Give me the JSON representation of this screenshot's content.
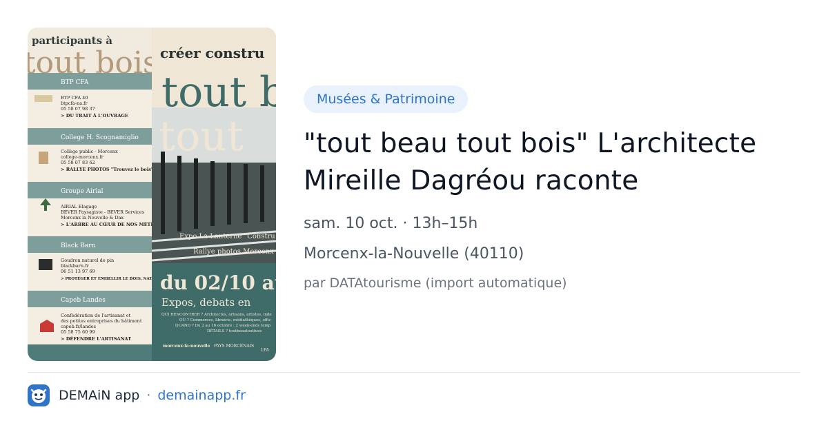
{
  "card": {
    "category": "Musées & Patrimoine",
    "title_line1": "\"tout beau tout bois\" L'architecte",
    "title_line2": "Mireille Dagréou raconte",
    "date_time": "sam. 10 oct. · 13h–15h",
    "location": "Morcenx-la-Nouvelle (40110)",
    "source": "par DATAtourisme (import automatique)"
  },
  "footer": {
    "app_name": "DEMAiN app",
    "separator": "·",
    "domain": "demainapp.fr",
    "icon": "demain-app-icon"
  },
  "poster": {
    "icon": "event-poster-image",
    "header_text": "participants à",
    "big_title_left": "tout bois",
    "tagline": "créer constru",
    "big_title_right_1": "tout b",
    "big_title_right_2": "tout",
    "expo_line": "Expo La Lanterne \"Constru",
    "rallye_line": "Rallye photos Morcenx",
    "dates": "du 02/10 au",
    "subtitle": "Expos, debats en",
    "partners": [
      {
        "name": "BTP CFA",
        "lines": [
          "BTP CFA 40",
          "btpcfa-na.fr",
          "05 58 07 98 37"
        ],
        "tag": "> DU TRAIT À L'OUVRAGE"
      },
      {
        "name": "College H. Scognamiglio",
        "lines": [
          "Collège public - Morcenx",
          "college-morcenx.fr",
          "05 58 07 83 62"
        ],
        "tag": "> RALLYE PHOTOS \"Trouvez le bois\""
      },
      {
        "name": "Groupe Airial",
        "lines": [
          "AIRIAL Elagage",
          "BEVER Paysagiste - BEVER Services",
          "Morcenx la Nouvelle & Dax"
        ],
        "tag": "> L'ARBRE AU CŒUR DE NOS MÉTIERS"
      },
      {
        "name": "Black Barn",
        "lines": [
          "Goudron naturel de pin",
          "blackbarn.fr",
          "06 51 13 97 69"
        ],
        "tag": "> PROTÉGER ET EMBELLIR LE BOIS, NATURELLEMENT, DURABLEMENT"
      },
      {
        "name": "Capeb Landes",
        "lines": [
          "Confédération de l'artisanat et",
          "des petites entreprises du bâtiment",
          "capeb.fr/landes",
          "05 58 75 60 99"
        ],
        "tag": "> DÉFENDRE L'ARTISANAT"
      }
    ],
    "info_lines": [
      "QUI RENCONTRER ? Architectes, artisans, artistes, inde",
      "OÙ ? Commerces, librairie, médiathèques, offic",
      "QUAND ? Du 2 au 16 octobre : 2 week-ends temp",
      "DÉTAILS ? toutbeautoutbois"
    ],
    "logos": [
      "morcenx-la-nouvelle",
      "PAYS MORCENAIS",
      "LPA"
    ]
  },
  "colors": {
    "teal": "#3f6c69",
    "teal_light": "#7d9e9b",
    "cream": "#f1ebdf",
    "badge_bg": "#e8f1fc",
    "link": "#2f74c8"
  }
}
